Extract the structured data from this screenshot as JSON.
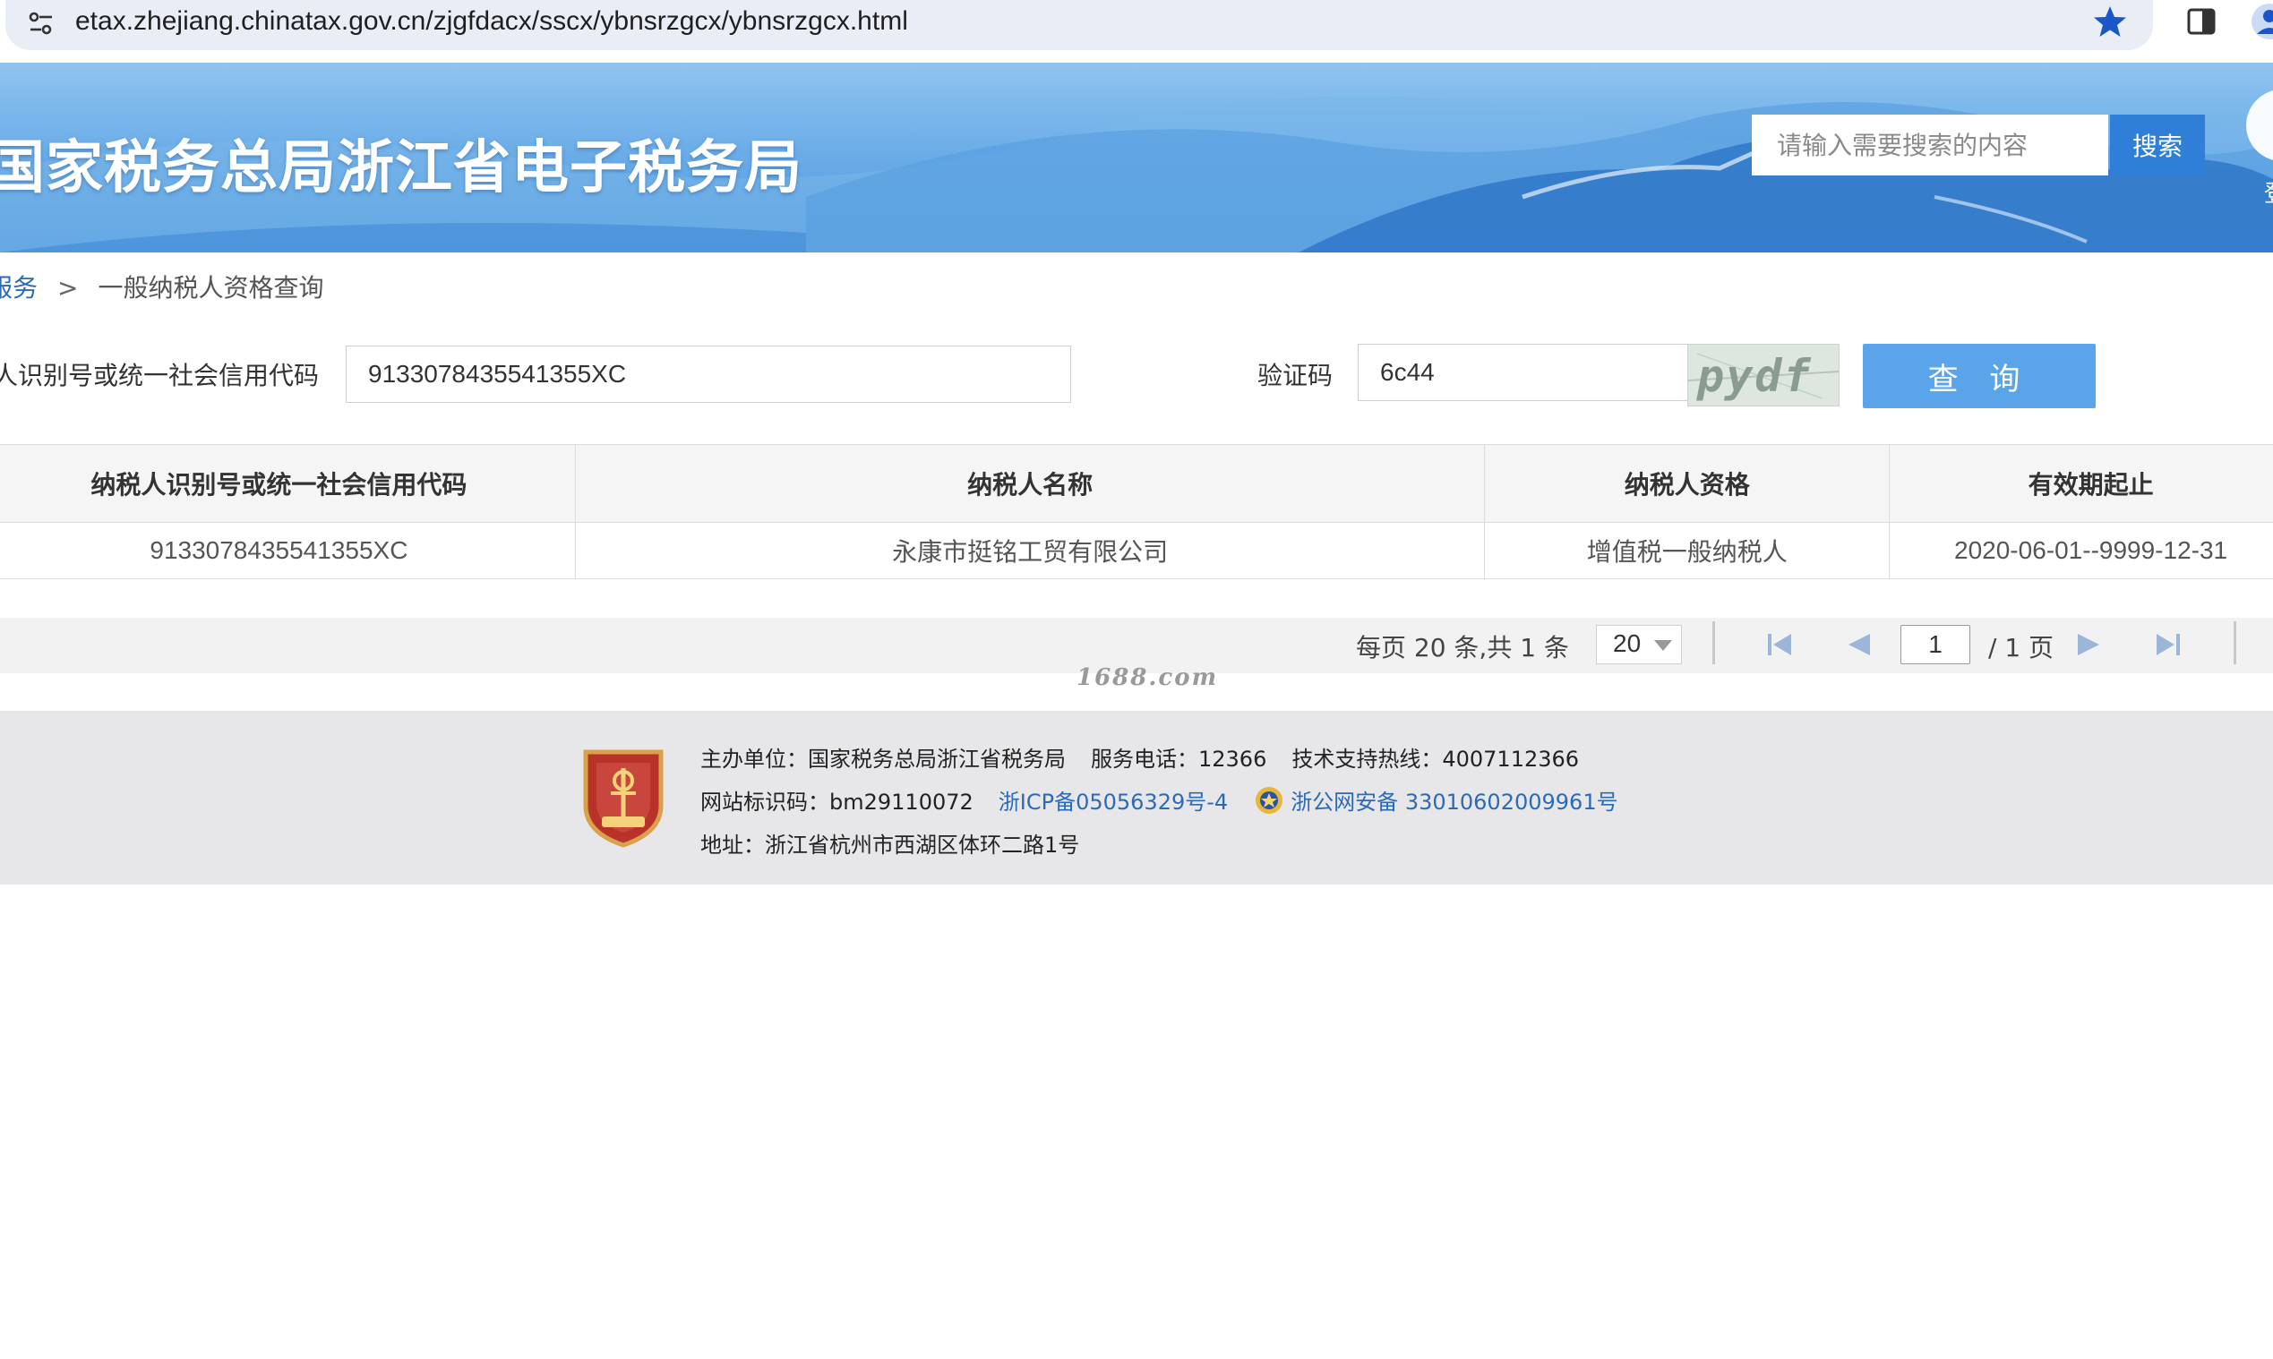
{
  "browser": {
    "url": "etax.zhejiang.chinatax.gov.cn/zjgfdacx/sscx/ybnsrzgcx/ybnsrzgcx.html",
    "icons": [
      "site-settings-icon",
      "bookmark-star-icon",
      "side-panel-icon",
      "profile-icon"
    ]
  },
  "banner": {
    "title": "国家税务总局浙江省电子税务局",
    "search_placeholder": "请输入需要搜索的内容",
    "search_button": "搜索",
    "login_label": "登"
  },
  "breadcrumb": {
    "parent": "服务",
    "separator": ">",
    "current": "一般纳税人资格查询"
  },
  "form": {
    "taxid_label": "人识别号或统一社会信用代码",
    "taxid_value": "9133078435541355XC",
    "captcha_label": "验证码",
    "captcha_value": "6c44",
    "captcha_image_text": "pydf",
    "query_button": "查 询"
  },
  "table": {
    "headers": [
      "纳税人识别号或统一社会信用代码",
      "纳税人名称",
      "纳税人资格",
      "有效期起止"
    ],
    "rows": [
      [
        "9133078435541355XC",
        "永康市挺铭工贸有限公司",
        "增值税一般纳税人",
        "2020-06-01--9999-12-31"
      ]
    ]
  },
  "pagination": {
    "info": "每页 20 条,共 1 条",
    "page_size": "20",
    "current_page": "1",
    "total_pages": "/ 1 页"
  },
  "watermark": "1688.com",
  "footer": {
    "sponsor": "主办单位：国家税务总局浙江省税务局",
    "service_phone": "服务电话：12366",
    "support_hotline": "技术支持热线：4007112366",
    "site_id": "网站标识码：bm29110072",
    "icp": "浙ICP备05056329号-4",
    "police_record": "浙公网安备 33010602009961号",
    "address": "地址：浙江省杭州市西湖区体环二路1号"
  },
  "colors": {
    "banner_blue": "#4b97de",
    "search_button": "#2f7fd8",
    "query_button": "#5aa5ea",
    "link": "#2c6ab8",
    "footer_bg": "#e7e7e9",
    "emblem_red": "#b8322a"
  }
}
